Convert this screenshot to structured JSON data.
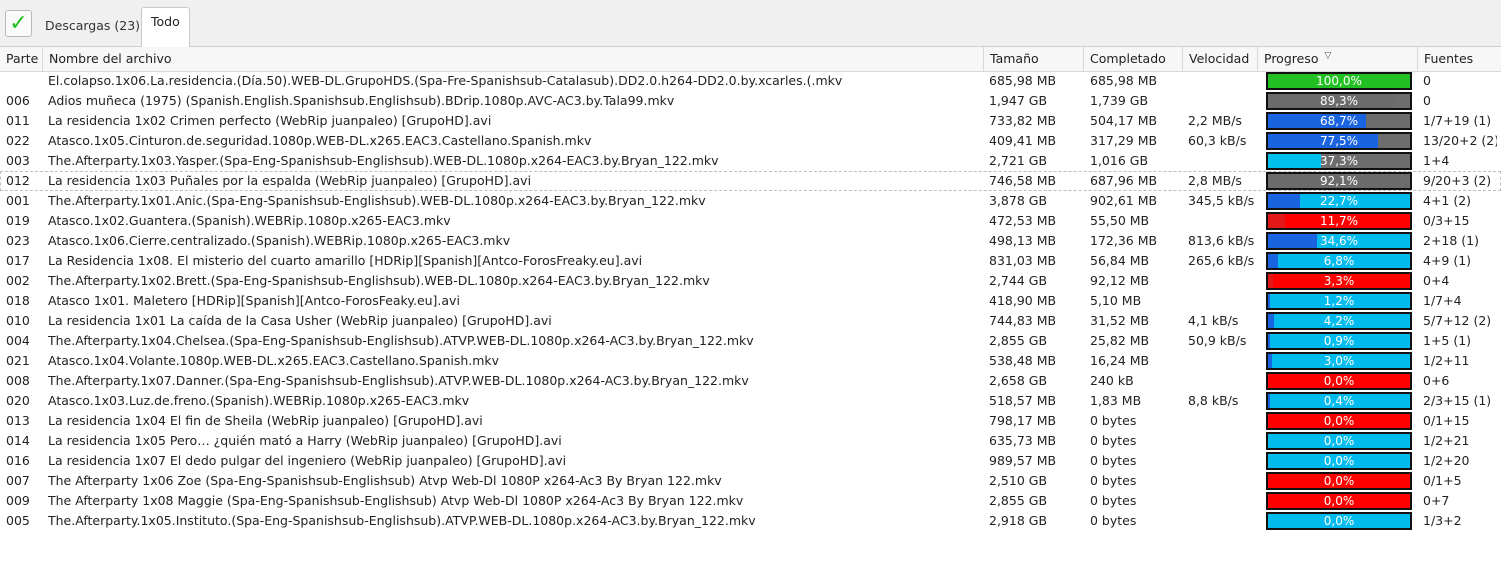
{
  "toolbar": {
    "check_icon": "checkmark-icon",
    "check_color": "#22c022"
  },
  "tabs": [
    {
      "label": "Descargas (23)"
    },
    {
      "label": "Todo"
    }
  ],
  "columns": {
    "part": "Parte",
    "name": "Nombre del archivo",
    "size": "Tamaño",
    "done": "Completado",
    "speed": "Velocidad",
    "progress": "Progreso",
    "sources": "Fuentes"
  },
  "colors": {
    "complete": "#22c022",
    "no_sources": "#ff0000",
    "partial": "#00bcee",
    "downloaded": "#1a64e0",
    "unavailable": "#6d6d6d"
  },
  "rows": [
    {
      "part": "",
      "name": "El.colapso.1x06.La.residencia.(Día.50).WEB-DL.GrupoHDS.(Spa-Fre-Spanishsub-Catalasub).DD2.0.h264-DD2.0.by.xcarles.(.mkv",
      "size": "685,98 MB",
      "done": "685,98 MB",
      "speed": "",
      "progress_label": "100,0%",
      "progress": 1.0,
      "bar": "green",
      "fill": "none",
      "sources": "0"
    },
    {
      "part": "006",
      "name": "Adios muñeca (1975) (Spanish.English.Spanishsub.Englishsub).BDrip.1080p.AVC-AC3.by.Tala99.mkv",
      "size": "1,947 GB",
      "done": "1,739 GB",
      "speed": "",
      "progress_label": "89,3%",
      "progress": 0.893,
      "bar": "gray",
      "fill": "gray",
      "sources": "0"
    },
    {
      "part": "011",
      "name": "La residencia 1x02 Crimen perfecto (WebRip juanpaleo) [GrupoHD].avi",
      "size": "733,82 MB",
      "done": "504,17 MB",
      "speed": "2,2 MB/s",
      "progress_label": "68,7%",
      "progress": 0.687,
      "bar": "gray",
      "fill": "blue",
      "sources": "1/7+19 (1)"
    },
    {
      "part": "022",
      "name": "Atasco.1x05.Cinturon.de.seguridad.1080p.WEB-DL.x265.EAC3.Castellano.Spanish.mkv",
      "size": "409,41 MB",
      "done": "317,29 MB",
      "speed": "60,3 kB/s",
      "progress_label": "77,5%",
      "progress": 0.775,
      "bar": "gray",
      "fill": "blue",
      "sources": "13/20+2 (2)"
    },
    {
      "part": "003",
      "name": "The.Afterparty.1x03.Yasper.(Spa-Eng-Spanishsub-Englishsub).WEB-DL.1080p.x264-EAC3.by.Bryan_122.mkv",
      "size": "2,721 GB",
      "done": "1,016 GB",
      "speed": "",
      "progress_label": "37,3%",
      "progress": 0.373,
      "bar": "gray",
      "fill": "cyan",
      "sources": "1+4"
    },
    {
      "part": "012",
      "name": "La residencia 1x03 Puñales por la espalda (WebRip juanpaleo) [GrupoHD].avi",
      "size": "746,58 MB",
      "done": "687,96 MB",
      "speed": "2,8 MB/s",
      "progress_label": "92,1%",
      "progress": 0.921,
      "bar": "gray",
      "fill": "gray",
      "sources": "9/20+3 (2)"
    },
    {
      "part": "001",
      "name": "The.Afterparty.1x01.Anic.(Spa-Eng-Spanishsub-Englishsub).WEB-DL.1080p.x264-EAC3.by.Bryan_122.mkv",
      "size": "3,878 GB",
      "done": "902,61 MB",
      "speed": "345,5 kB/s",
      "progress_label": "22,7%",
      "progress": 0.227,
      "bar": "cyan",
      "fill": "blue",
      "sources": "4+1 (2)"
    },
    {
      "part": "019",
      "name": "Atasco.1x02.Guantera.(Spanish).WEBRip.1080p.x265-EAC3.mkv",
      "size": "472,53 MB",
      "done": "55,50 MB",
      "speed": "",
      "progress_label": "11,7%",
      "progress": 0.117,
      "bar": "red",
      "fill": "red",
      "sources": "0/3+15"
    },
    {
      "part": "023",
      "name": "Atasco.1x06.Cierre.centralizado.(Spanish).WEBRip.1080p.x265-EAC3.mkv",
      "size": "498,13 MB",
      "done": "172,36 MB",
      "speed": "813,6 kB/s",
      "progress_label": "34,6%",
      "progress": 0.346,
      "bar": "cyan",
      "fill": "blue",
      "sources": "2+18 (1)"
    },
    {
      "part": "017",
      "name": "La Residencia 1x08. El misterio del cuarto amarillo [HDRip][Spanish][Antco-ForosFreaky.eu].avi",
      "size": "831,03 MB",
      "done": "56,84 MB",
      "speed": "265,6 kB/s",
      "progress_label": "6,8%",
      "progress": 0.068,
      "bar": "cyan",
      "fill": "blue",
      "sources": "4+9 (1)"
    },
    {
      "part": "002",
      "name": "The.Afterparty.1x02.Brett.(Spa-Eng-Spanishsub-Englishsub).WEB-DL.1080p.x264-EAC3.by.Bryan_122.mkv",
      "size": "2,744 GB",
      "done": "92,12 MB",
      "speed": "",
      "progress_label": "3,3%",
      "progress": 0.033,
      "bar": "red",
      "fill": "red",
      "sources": "0+4"
    },
    {
      "part": "018",
      "name": "Atasco 1x01. Maletero [HDRip][Spanish][Antco-ForosFeaky.eu].avi",
      "size": "418,90 MB",
      "done": "5,10 MB",
      "speed": "",
      "progress_label": "1,2%",
      "progress": 0.012,
      "bar": "cyan",
      "fill": "blue",
      "sources": "1/7+4"
    },
    {
      "part": "010",
      "name": "La residencia 1x01 La caída de la Casa Usher (WebRip juanpaleo) [GrupoHD].avi",
      "size": "744,83 MB",
      "done": "31,52 MB",
      "speed": "4,1 kB/s",
      "progress_label": "4,2%",
      "progress": 0.042,
      "bar": "cyan",
      "fill": "blue",
      "sources": "5/7+12 (2)"
    },
    {
      "part": "004",
      "name": "The.Afterparty.1x04.Chelsea.(Spa-Eng-Spanishsub-Englishsub).ATVP.WEB-DL.1080p.x264-AC3.by.Bryan_122.mkv",
      "size": "2,855 GB",
      "done": "25,82 MB",
      "speed": "50,9 kB/s",
      "progress_label": "0,9%",
      "progress": 0.009,
      "bar": "cyan",
      "fill": "blue",
      "sources": "1+5 (1)"
    },
    {
      "part": "021",
      "name": "Atasco.1x04.Volante.1080p.WEB-DL.x265.EAC3.Castellano.Spanish.mkv",
      "size": "538,48 MB",
      "done": "16,24 MB",
      "speed": "",
      "progress_label": "3,0%",
      "progress": 0.03,
      "bar": "cyan",
      "fill": "blue",
      "sources": "1/2+11"
    },
    {
      "part": "008",
      "name": "The.Afterparty.1x07.Danner.(Spa-Eng-Spanishsub-Englishsub).ATVP.WEB-DL.1080p.x264-AC3.by.Bryan_122.mkv",
      "size": "2,658 GB",
      "done": "240 kB",
      "speed": "",
      "progress_label": "0,0%",
      "progress": 0.0,
      "bar": "red",
      "fill": "none",
      "sources": "0+6"
    },
    {
      "part": "020",
      "name": "Atasco.1x03.Luz.de.freno.(Spanish).WEBRip.1080p.x265-EAC3.mkv",
      "size": "518,57 MB",
      "done": "1,83 MB",
      "speed": "8,8 kB/s",
      "progress_label": "0,4%",
      "progress": 0.004,
      "bar": "cyan",
      "fill": "blue",
      "sources": "2/3+15 (1)"
    },
    {
      "part": "013",
      "name": "La residencia 1x04 El fin de Sheila (WebRip juanpaleo) [GrupoHD].avi",
      "size": "798,17 MB",
      "done": "0 bytes",
      "speed": "",
      "progress_label": "0,0%",
      "progress": 0.0,
      "bar": "red",
      "fill": "none",
      "sources": "0/1+15"
    },
    {
      "part": "014",
      "name": "La residencia 1x05 Pero… ¿quién mató a Harry (WebRip juanpaleo) [GrupoHD].avi",
      "size": "635,73 MB",
      "done": "0 bytes",
      "speed": "",
      "progress_label": "0,0%",
      "progress": 0.0,
      "bar": "cyan",
      "fill": "none",
      "sources": "1/2+21"
    },
    {
      "part": "016",
      "name": "La residencia 1x07 El dedo pulgar del ingeniero (WebRip juanpaleo) [GrupoHD].avi",
      "size": "989,57 MB",
      "done": "0 bytes",
      "speed": "",
      "progress_label": "0,0%",
      "progress": 0.0,
      "bar": "cyan",
      "fill": "none",
      "sources": "1/2+20"
    },
    {
      "part": "007",
      "name": "The Afterparty 1x06 Zoe (Spa-Eng-Spanishsub-Englishsub) Atvp Web-Dl 1080P x264-Ac3 By Bryan 122.mkv",
      "size": "2,510 GB",
      "done": "0 bytes",
      "speed": "",
      "progress_label": "0,0%",
      "progress": 0.0,
      "bar": "red",
      "fill": "none",
      "sources": "0/1+5"
    },
    {
      "part": "009",
      "name": "The Afterparty 1x08 Maggie (Spa-Eng-Spanishsub-Englishsub) Atvp Web-Dl 1080P x264-Ac3 By Bryan 122.mkv",
      "size": "2,855 GB",
      "done": "0 bytes",
      "speed": "",
      "progress_label": "0,0%",
      "progress": 0.0,
      "bar": "red",
      "fill": "none",
      "sources": "0+7"
    },
    {
      "part": "005",
      "name": "The.Afterparty.1x05.Instituto.(Spa-Eng-Spanishsub-Englishsub).ATVP.WEB-DL.1080p.x264-AC3.by.Bryan_122.mkv",
      "size": "2,918 GB",
      "done": "0 bytes",
      "speed": "",
      "progress_label": "0,0%",
      "progress": 0.0,
      "bar": "cyan",
      "fill": "none",
      "sources": "1/3+2"
    }
  ]
}
